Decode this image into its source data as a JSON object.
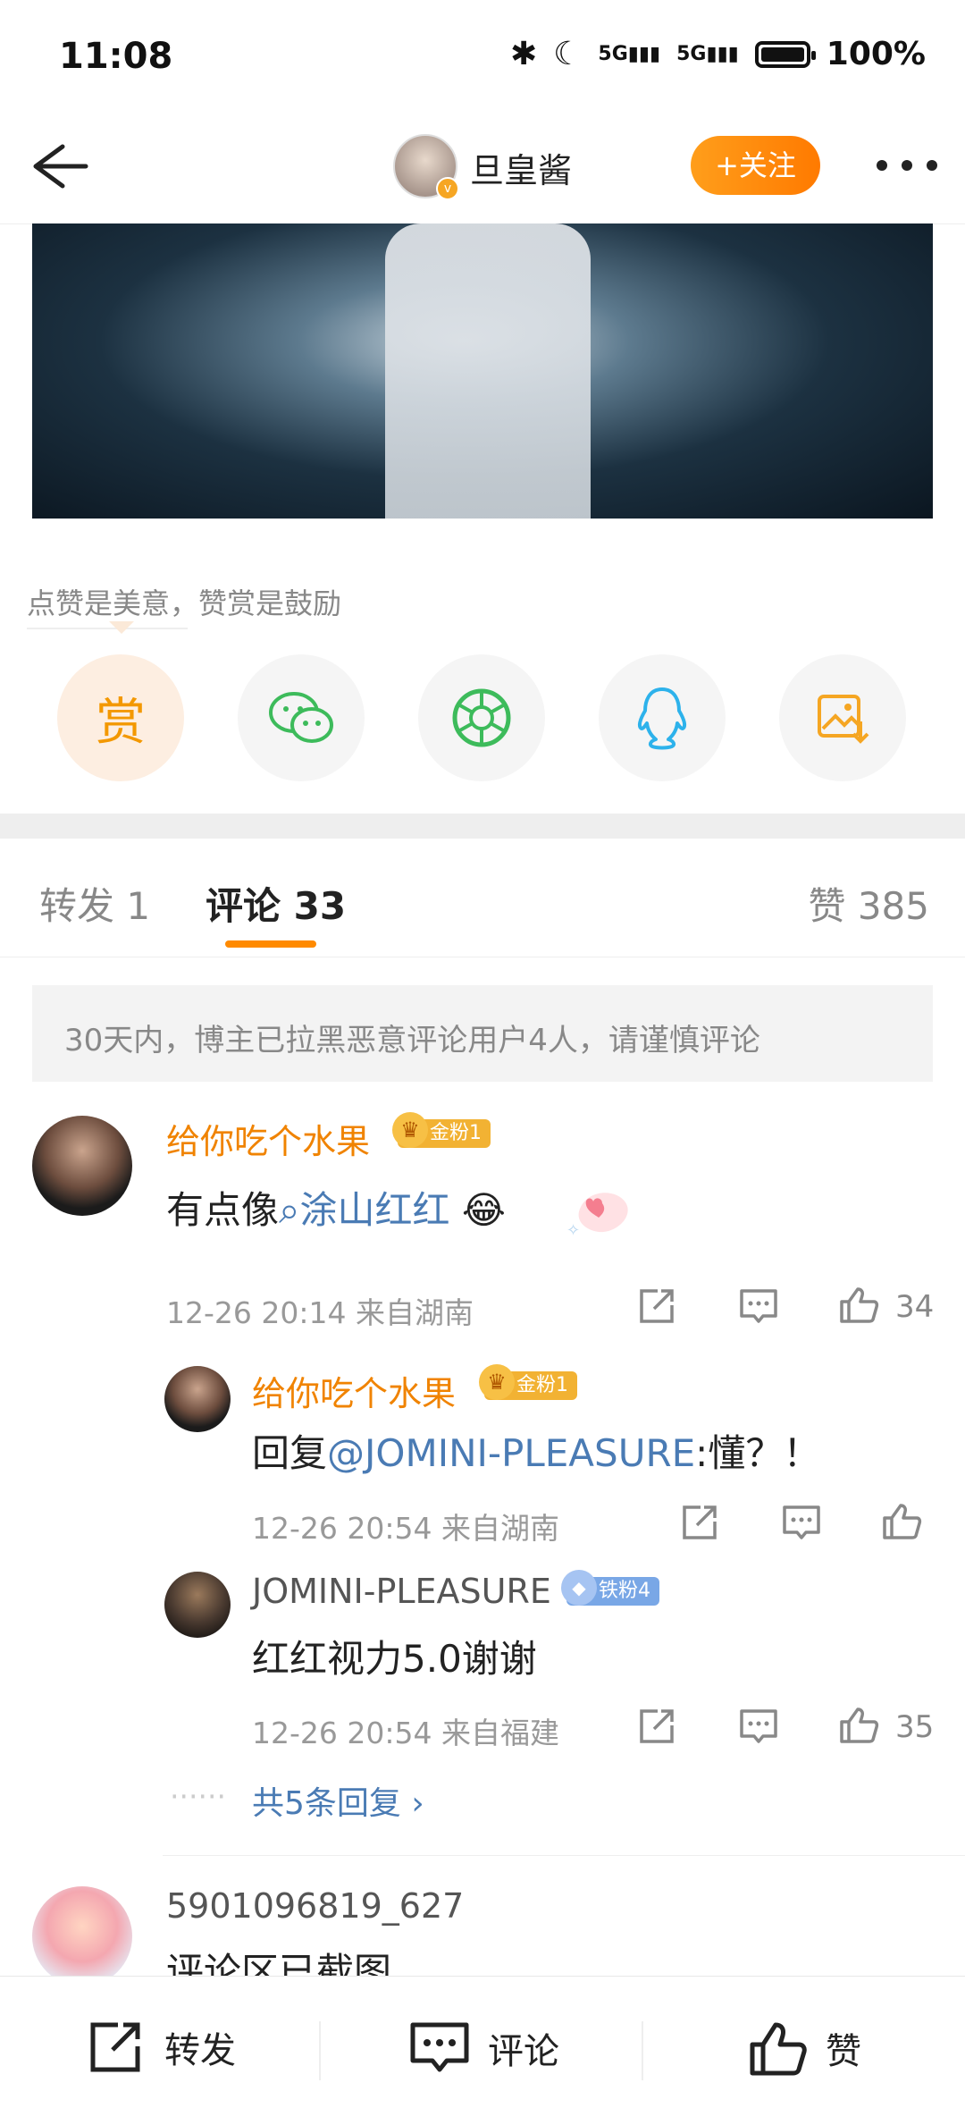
{
  "status_bar": {
    "time": "11:08",
    "battery": "100%"
  },
  "header": {
    "nickname": "旦皇酱",
    "follow_label": "+关注"
  },
  "reward": {
    "tip": "点赞是美意，赞赏是鼓励",
    "reward_label": "赏"
  },
  "tabs": {
    "repost": "转发 1",
    "comment": "评论 33",
    "like": "赞 385"
  },
  "notice": "30天内，博主已拉黑恶意评论用户4人，请谨慎评论",
  "comments": [
    {
      "user": "给你吃个水果",
      "badge": "金粉1",
      "text_prefix": "有点像",
      "text_link": "涂山红红",
      "emoji": "😂",
      "time": "12-26 20:14",
      "location": "来自湖南",
      "likes": "34",
      "replies": [
        {
          "user": "给你吃个水果",
          "badge": "金粉1",
          "text_prefix": "回复",
          "text_link": "@JOMINI-PLEASURE",
          "text_suffix": ":懂？！",
          "time": "12-26 20:54",
          "location": "来自湖南",
          "likes": ""
        },
        {
          "user": "JOMINI-PLEASURE",
          "badge": "铁粉4",
          "text": "红红视力5.0谢谢",
          "time": "12-26 20:54",
          "location": "来自福建",
          "likes": "35"
        }
      ],
      "more_replies": "共5条回复"
    },
    {
      "user": "5901096819_627",
      "text": "评论区已截图"
    }
  ],
  "bottom_bar": {
    "repost": "转发",
    "comment": "评论",
    "like": "赞"
  }
}
